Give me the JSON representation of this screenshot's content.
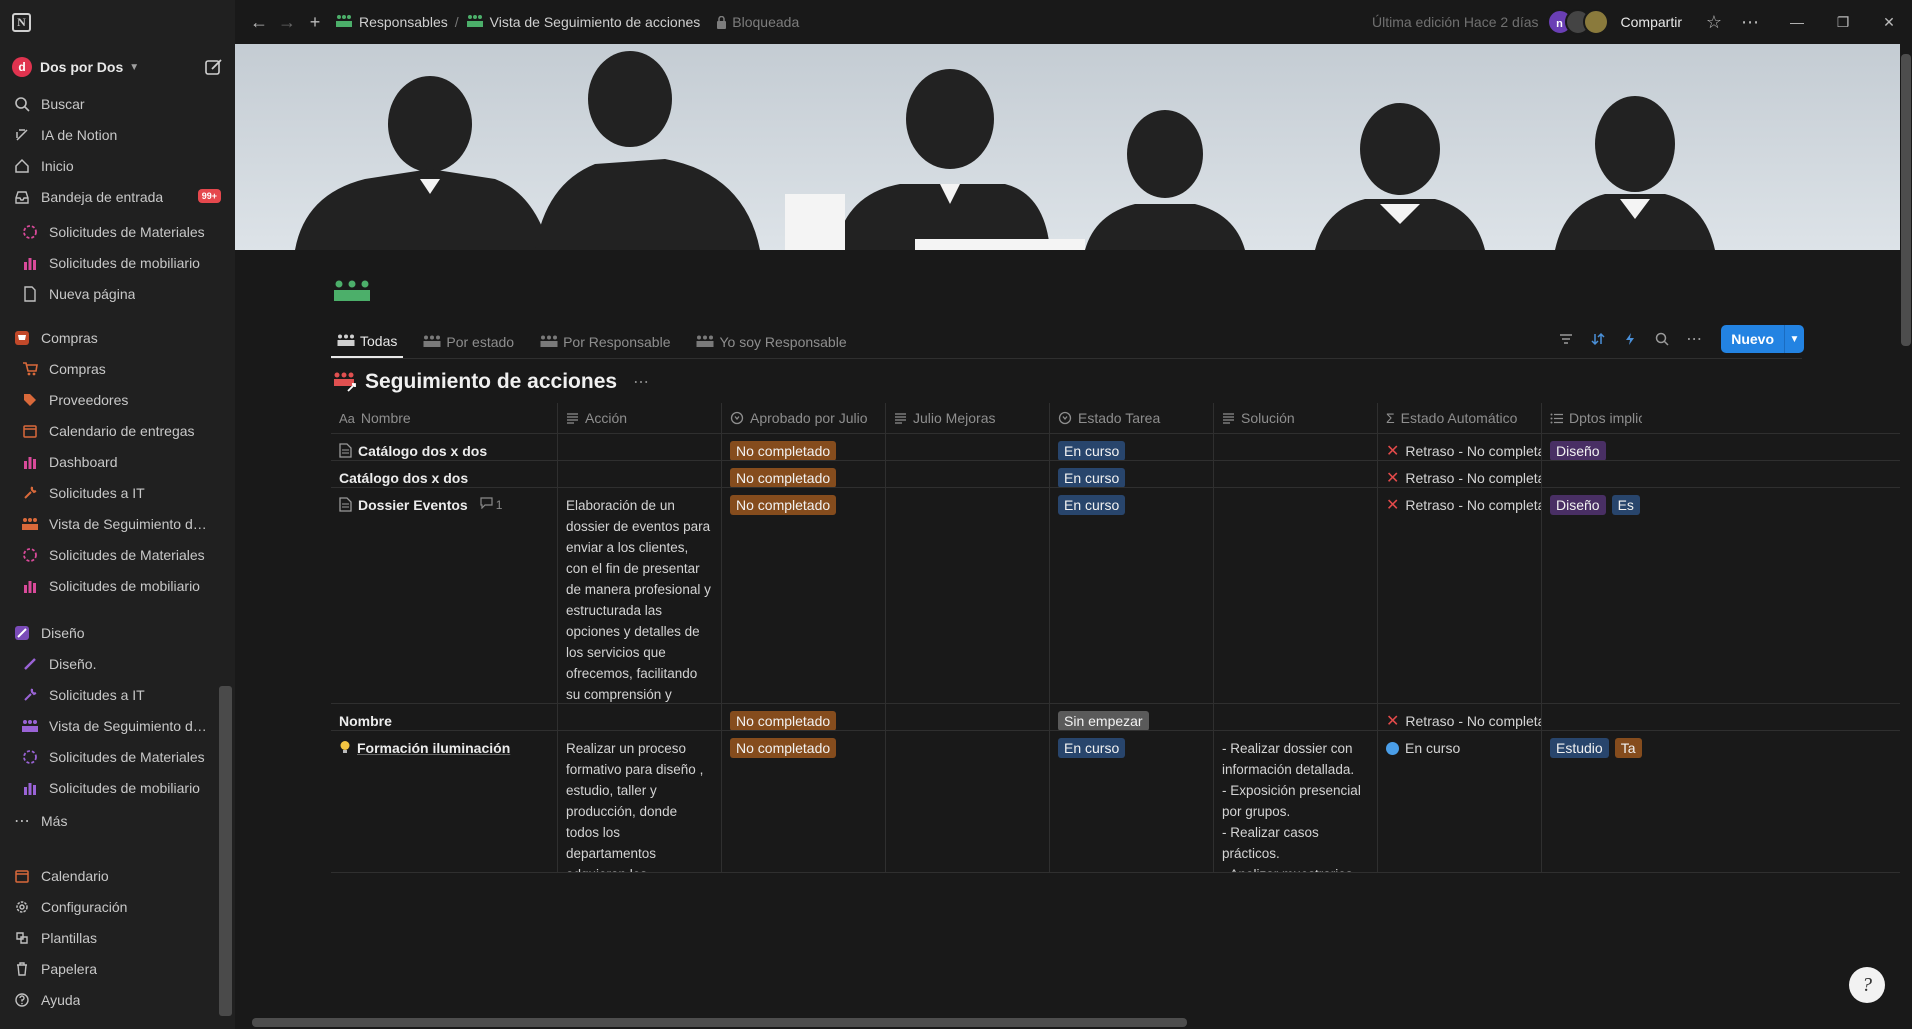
{
  "sidebar": {
    "workspace_initial": "d",
    "workspace_name": "Dos por Dos",
    "top_items": [
      {
        "label": "Buscar",
        "icon": "search-icon"
      },
      {
        "label": "IA de Notion",
        "icon": "notion-ai-icon"
      },
      {
        "label": "Inicio",
        "icon": "home-icon"
      },
      {
        "label": "Bandeja de entrada",
        "icon": "inbox-icon",
        "badge": "99+"
      }
    ],
    "recent": [
      {
        "label": "Solicitudes de Materiales",
        "icon": "dashed-circle-icon"
      },
      {
        "label": "Solicitudes de mobiliario",
        "icon": "chart-icon"
      },
      {
        "label": "Nueva página",
        "icon": "page-icon"
      }
    ],
    "compras": {
      "title": "Compras",
      "items": [
        {
          "label": "Compras",
          "icon": "cart-icon"
        },
        {
          "label": "Proveedores",
          "icon": "tag-icon"
        },
        {
          "label": "Calendario de entregas",
          "icon": "calendar-icon"
        },
        {
          "label": "Dashboard",
          "icon": "chart-icon"
        },
        {
          "label": "Solicitudes a IT",
          "icon": "wrench-icon"
        },
        {
          "label": "Vista de Seguimiento de acciones",
          "icon": "people-icon"
        },
        {
          "label": "Solicitudes de Materiales",
          "icon": "dashed-circle-icon"
        },
        {
          "label": "Solicitudes de mobiliario",
          "icon": "chart-icon"
        }
      ]
    },
    "diseno": {
      "title": "Diseño",
      "items": [
        {
          "label": "Diseño.",
          "icon": "brush-icon"
        },
        {
          "label": "Solicitudes a IT",
          "icon": "wrench-icon"
        },
        {
          "label": "Vista de Seguimiento de acciones",
          "icon": "people-icon"
        },
        {
          "label": "Solicitudes de Materiales",
          "icon": "dashed-circle-icon"
        },
        {
          "label": "Solicitudes de mobiliario",
          "icon": "chart-icon"
        }
      ]
    },
    "more": "Más",
    "bottom_items": [
      {
        "label": "Calendario",
        "icon": "calendar-icon"
      },
      {
        "label": "Configuración",
        "icon": "gear-icon"
      },
      {
        "label": "Plantillas",
        "icon": "templates-icon"
      },
      {
        "label": "Papelera",
        "icon": "trash-icon"
      },
      {
        "label": "Ayuda",
        "icon": "help-icon"
      }
    ]
  },
  "topbar": {
    "breadcrumb": [
      "Responsables",
      "Vista de Seguimiento de acciones"
    ],
    "lock_label": "Bloqueada",
    "last_edit": "Última edición Hace 2 días",
    "avatar_initial": "n",
    "share_label": "Compartir"
  },
  "views": {
    "tabs": [
      "Todas",
      "Por estado",
      "Por Responsable",
      "Yo soy Responsable"
    ],
    "active_tab": "Todas",
    "new_label": "Nuevo"
  },
  "database": {
    "title": "Seguimiento de acciones",
    "columns": [
      {
        "label": "Nombre",
        "icon": "Aa"
      },
      {
        "label": "Acción",
        "icon": "text-icon"
      },
      {
        "label": "Aprobado por Julio",
        "icon": "status-icon"
      },
      {
        "label": "Julio Mejoras",
        "icon": "text-icon"
      },
      {
        "label": "Estado Tarea",
        "icon": "status-icon"
      },
      {
        "label": "Solución",
        "icon": "text-icon"
      },
      {
        "label": "Estado Automático",
        "icon": "formula-icon"
      },
      {
        "label": "Dptos implicados",
        "icon": "list-icon"
      }
    ],
    "rows": [
      {
        "name": "Catálogo dos x dos",
        "doc": true,
        "comments": "",
        "accion": "",
        "aprobado": "No completado",
        "mejoras": "",
        "estado": "En curso",
        "estado_color": "blue",
        "solucion": "",
        "auto": "Retraso - No completado",
        "auto_kind": "x",
        "dptos": [
          "Diseño"
        ]
      },
      {
        "name": "Catálogo dos x dos",
        "doc": false,
        "comments": "",
        "accion": "",
        "aprobado": "No completado",
        "mejoras": "",
        "estado": "En curso",
        "estado_color": "blue",
        "solucion": "",
        "auto": "Retraso - No completado",
        "auto_kind": "x",
        "dptos": []
      },
      {
        "name": "Dossier Eventos",
        "doc": true,
        "comments": "1",
        "accion": "Elaboración de un dossier de eventos para enviar a los clientes, con el fin de presentar de manera profesional y estructurada las opciones y detalles de los servicios que ofrecemos, facilitando su comprensión y favoreciendo la toma de decisiones.",
        "aprobado": "No completado",
        "mejoras": "",
        "estado": "En curso",
        "estado_color": "blue",
        "solucion": "",
        "auto": "Retraso - No completado",
        "auto_kind": "x",
        "dptos": [
          "Diseño",
          "Es"
        ]
      },
      {
        "name": "Nombre",
        "doc": false,
        "comments": "",
        "accion": "",
        "aprobado": "No completado",
        "mejoras": "",
        "estado": "Sin empezar",
        "estado_color": "gray",
        "solucion": "",
        "auto": "Retraso - No completado",
        "auto_kind": "x",
        "dptos": []
      },
      {
        "name": "Formación iluminación",
        "doc": false,
        "bulb": true,
        "comments": "",
        "accion": "Realizar un proceso formativo para diseño , estudio, taller y producción, donde todos los departamentos adquieran los conocimientos necesarios para agilizar el trabajo, los diseños y reducir las incidencias.",
        "aprobado": "No completado",
        "mejoras": "",
        "estado": "En curso",
        "estado_color": "blue",
        "solucion": "- Realizar dossier con información detallada.\n- Exposición presencial por grupos.\n- Realizar casos prácticos.\n- Analizar muestrarios.",
        "auto": "En curso",
        "auto_kind": "dot",
        "dptos": [
          "Estudio",
          "Ta"
        ]
      }
    ]
  },
  "colors": {
    "accent": "#2383e2",
    "orange_pill": "#854c1d",
    "blue_pill": "#28456c",
    "gray_pill": "#5a5a5a",
    "purple_pill": "#492f64",
    "retraso_x": "#e34a4a",
    "cover_sky": "#d5dce2"
  }
}
